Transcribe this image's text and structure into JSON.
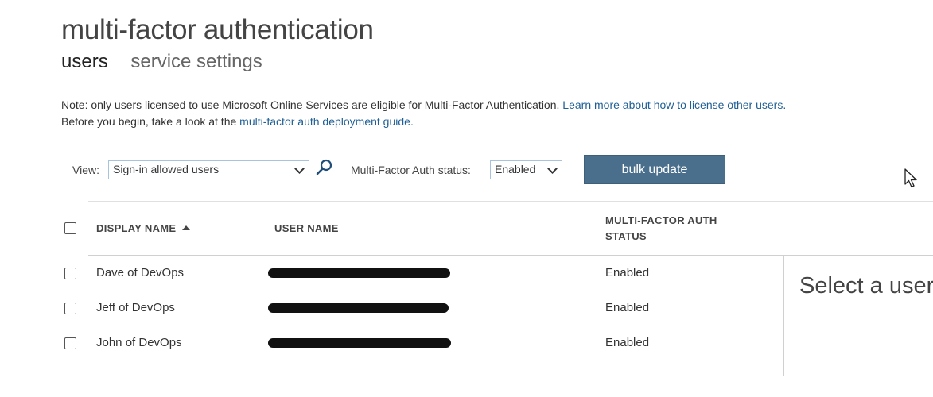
{
  "header": {
    "title": "multi-factor authentication",
    "tabs": [
      {
        "label": "users",
        "active": true
      },
      {
        "label": "service settings",
        "active": false
      }
    ]
  },
  "note": {
    "line1_text": "Note: only users licensed to use Microsoft Online Services are eligible for Multi-Factor Authentication.",
    "line1_link": "Learn more about how to license other users.",
    "line2_text": "Before you begin, take a look at the",
    "line2_link": "multi-factor auth deployment guide."
  },
  "toolbar": {
    "view_label": "View:",
    "view_value": "Sign-in allowed users",
    "search_icon": "search-icon",
    "mfa_status_label": "Multi-Factor Auth status:",
    "mfa_status_value": "Enabled",
    "bulk_update_label": "bulk update"
  },
  "table": {
    "columns": {
      "display_name": "DISPLAY NAME",
      "user_name": "USER NAME",
      "mfa_status_line1": "MULTI-FACTOR AUTH",
      "mfa_status_line2": "STATUS"
    },
    "sort": {
      "column": "display_name",
      "direction": "ascending"
    },
    "rows": [
      {
        "display_name": "Dave of DevOps",
        "user_name": "",
        "status": "Enabled"
      },
      {
        "display_name": "Jeff of DevOps",
        "user_name": "",
        "status": "Enabled"
      },
      {
        "display_name": "John of DevOps",
        "user_name": "",
        "status": "Enabled"
      }
    ]
  },
  "detail_panel": {
    "title": "Select a user"
  },
  "colors": {
    "link": "#1f5f95",
    "button_bg": "#4a6f8c",
    "select_border": "#a8c4dd"
  }
}
